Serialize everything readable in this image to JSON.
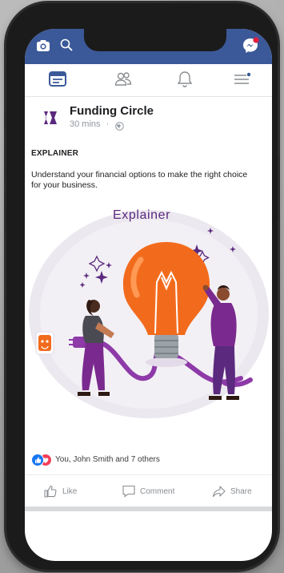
{
  "post": {
    "page_name": "Funding Circle",
    "time": "30 mins",
    "separator": "·",
    "label": "EXPLAINER",
    "text": "Understand your financial options to make the right choice for your business.",
    "image_title": "Explainer"
  },
  "reactions": {
    "summary": "You, John Smith and 7 others"
  },
  "actions": {
    "like": "Like",
    "comment": "Comment",
    "share": "Share"
  },
  "icons": {
    "status_left": [
      "camera-icon",
      "search-icon"
    ],
    "status_right": "messenger-icon",
    "nav": [
      "feed-icon",
      "friends-icon",
      "notifications-icon",
      "menu-icon"
    ]
  },
  "colors": {
    "brand_blue": "#3b5998",
    "purple": "#5b2a7e",
    "orange": "#f26b1d",
    "notification_red": "#e41e3f"
  }
}
